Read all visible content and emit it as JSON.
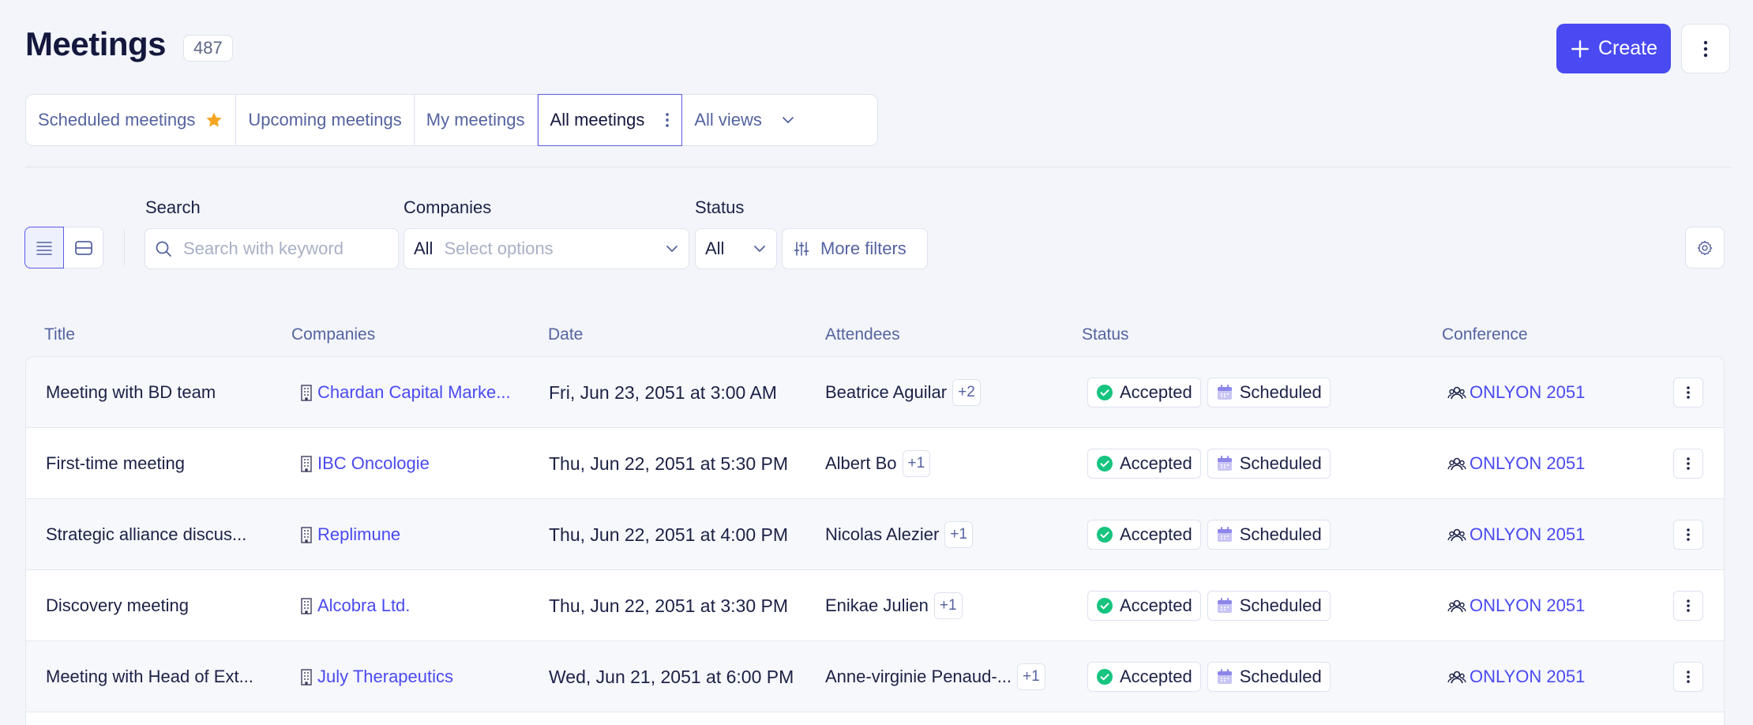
{
  "header": {
    "title": "Meetings",
    "count": "487",
    "create_label": "Create"
  },
  "tabs": [
    {
      "label": "Scheduled meetings",
      "starred": true
    },
    {
      "label": "Upcoming meetings"
    },
    {
      "label": "My meetings"
    },
    {
      "label": "All meetings",
      "active": true
    },
    {
      "label": "All views",
      "dropdown": true
    }
  ],
  "filters": {
    "search_label": "Search",
    "search_placeholder": "Search with keyword",
    "search_value": "",
    "companies_label": "Companies",
    "companies_value": "All",
    "companies_placeholder": "Select options",
    "status_label": "Status",
    "status_value": "All",
    "more_filters_label": "More filters"
  },
  "table": {
    "columns": {
      "title": "Title",
      "companies": "Companies",
      "date": "Date",
      "attendees": "Attendees",
      "status": "Status",
      "conference": "Conference"
    },
    "rows": [
      {
        "title": "Meeting with BD team",
        "company": "Chardan Capital Marke...",
        "date": "Fri, Jun 23, 2051 at 3:00 AM",
        "attendee": "Beatrice Aguilar",
        "extra": "+2",
        "response": "Accepted",
        "schedule": "Scheduled",
        "conference": "ONLYON 2051"
      },
      {
        "title": "First-time meeting",
        "company": "IBC Oncologie",
        "date": "Thu, Jun 22, 2051 at 5:30 PM",
        "attendee": "Albert Bo",
        "extra": "+1",
        "response": "Accepted",
        "schedule": "Scheduled",
        "conference": "ONLYON 2051"
      },
      {
        "title": "Strategic alliance discus...",
        "company": "Replimune",
        "date": "Thu, Jun 22, 2051 at 4:00 PM",
        "attendee": "Nicolas Alezier",
        "extra": "+1",
        "response": "Accepted",
        "schedule": "Scheduled",
        "conference": "ONLYON 2051"
      },
      {
        "title": "Discovery meeting",
        "company": "Alcobra Ltd.",
        "date": "Thu, Jun 22, 2051 at 3:30 PM",
        "attendee": "Enikae Julien",
        "extra": "+1",
        "response": "Accepted",
        "schedule": "Scheduled",
        "conference": "ONLYON 2051"
      },
      {
        "title": "Meeting with Head of Ext...",
        "company": "July Therapeutics",
        "date": "Wed, Jun 21, 2051 at 6:00 PM",
        "attendee": "Anne-virginie Penaud-...",
        "extra": "+1",
        "response": "Accepted",
        "schedule": "Scheduled",
        "conference": "ONLYON 2051"
      }
    ]
  },
  "colors": {
    "accent": "#4a4af2",
    "accepted": "#16c47f",
    "star": "#f5a623",
    "background": "#f3f5fa"
  }
}
